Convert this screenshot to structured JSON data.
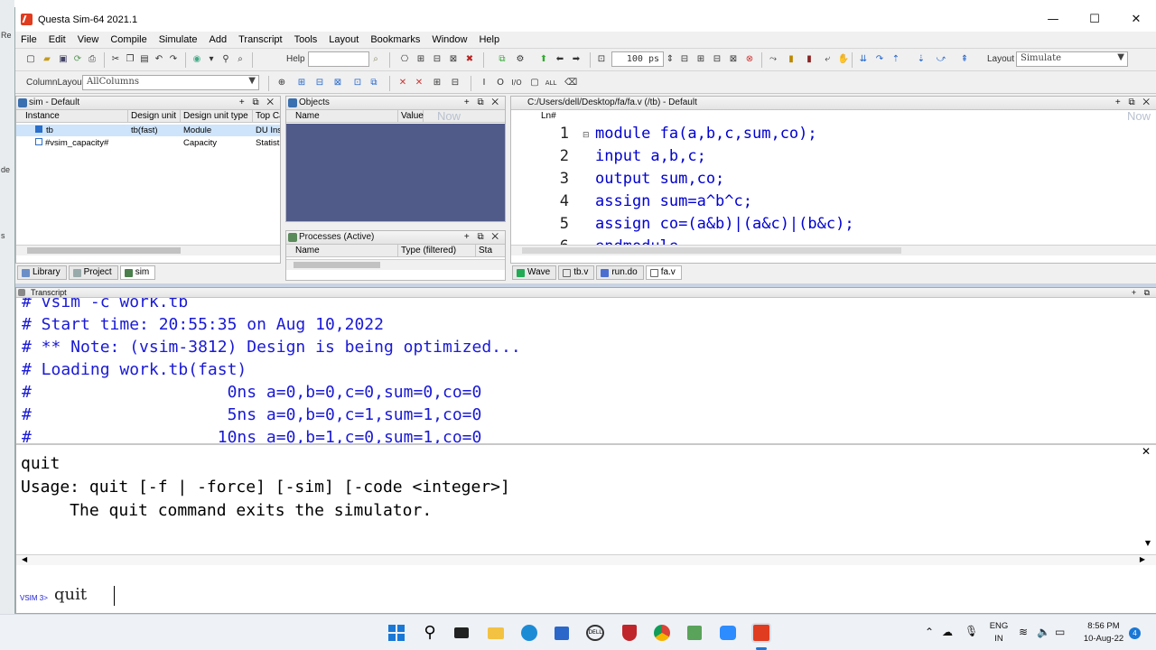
{
  "window": {
    "title": "Questa Sim-64 2021.1",
    "controls": {
      "minimize": "—",
      "maximize": "☐",
      "close": "✕"
    }
  },
  "desktop_strip": [
    "Re",
    "de",
    "s"
  ],
  "menu": [
    "File",
    "Edit",
    "View",
    "Compile",
    "Simulate",
    "Add",
    "Transcript",
    "Tools",
    "Layout",
    "Bookmarks",
    "Window",
    "Help"
  ],
  "toolbar": {
    "help_label": "Help",
    "time_value": "100 ps",
    "layout_label": "Layout",
    "layout_value": "Simulate",
    "column_layout_label": "ColumnLayout",
    "column_layout_value": "AllColumns"
  },
  "sim_pane": {
    "title": "sim - Default",
    "columns": [
      "Instance",
      "Design unit",
      "Design unit type",
      "Top Ca"
    ],
    "rows": [
      {
        "instance": "tb",
        "design_unit": "tb(fast)",
        "type": "Module",
        "top": "DU Ins"
      },
      {
        "instance": "#vsim_capacity#",
        "design_unit": "",
        "type": "Capacity",
        "top": "Statist"
      }
    ],
    "tabs": [
      "Library",
      "Project",
      "sim"
    ],
    "active_tab": "sim"
  },
  "objects_pane": {
    "title": "Objects",
    "columns": [
      "Name",
      "Value",
      "Now"
    ]
  },
  "processes_pane": {
    "title": "Processes (Active)",
    "columns": [
      "Name",
      "Type (filtered)",
      "Sta"
    ]
  },
  "source_pane": {
    "title": "C:/Users/dell/Desktop/fa/fa.v (/tb) - Default",
    "ln_header": "Ln#",
    "now_label": "Now",
    "lines": [
      {
        "n": "1",
        "code": "module fa(a,b,c,sum,co);"
      },
      {
        "n": "2",
        "code": "input a,b,c;"
      },
      {
        "n": "3",
        "code": "output sum,co;"
      },
      {
        "n": "4",
        "code": "assign sum=a^b^c;"
      },
      {
        "n": "5",
        "code": "assign co=(a&b)|(a&c)|(b&c);"
      },
      {
        "n": "6",
        "code": "endmodule"
      }
    ],
    "tabs": [
      "Wave",
      "tb.v",
      "run.do",
      "fa.v"
    ],
    "active_tab": "fa.v"
  },
  "transcript": {
    "title": "Transcript",
    "lines": [
      "# vsim -c work.tb",
      "# Start time: 20:55:35 on Aug 10,2022",
      "# ** Note: (vsim-3812) Design is being optimized...",
      "# Loading work.tb(fast)",
      "#                    0ns a=0,b=0,c=0,sum=0,co=0",
      "#                    5ns a=0,b=0,c=1,sum=1,co=0",
      "#                   10ns a=0,b=1,c=0,sum=1,co=0"
    ],
    "lower_lines": [
      "quit",
      "Usage: quit [-f | -force] [-sim] [-code <integer>]",
      "     The quit command exits the simulator."
    ],
    "prompt": "VSIM 3>",
    "command": "quit"
  },
  "taskbar": {
    "lang_top": "ENG",
    "lang_bottom": "IN",
    "time": "8:56 PM",
    "date": "10-Aug-22",
    "notif_count": "4"
  }
}
